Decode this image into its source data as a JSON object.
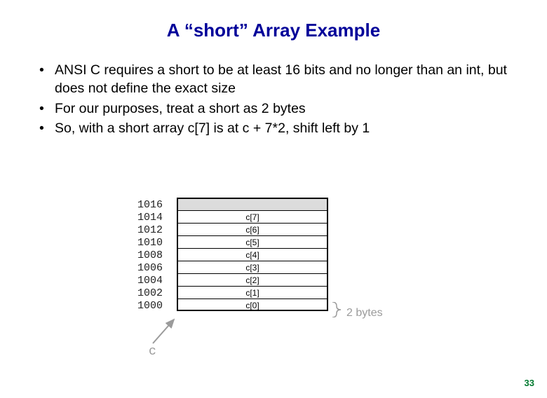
{
  "title": "A “short” Array Example",
  "bullets": [
    "ANSI C requires a short to be at least 16 bits and no longer than an int, but does not define the exact size",
    "For our purposes, treat a short as 2 bytes",
    "So, with a short array c[7] is at c + 7*2, shift left by 1"
  ],
  "diagram": {
    "addresses": [
      "1016",
      "1014",
      "1012",
      "1010",
      "1008",
      "1006",
      "1004",
      "1002",
      "1000"
    ],
    "cells": [
      "",
      "c[7]",
      "c[6]",
      "c[5]",
      "c[4]",
      "c[3]",
      "c[2]",
      "c[1]",
      "c[0]"
    ],
    "brace_label": "2 bytes",
    "base_label": "c"
  },
  "page_number": "33"
}
